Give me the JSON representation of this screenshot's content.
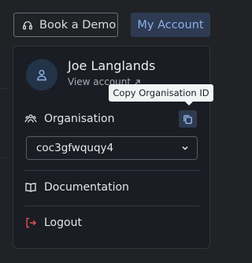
{
  "header": {
    "book_demo_label": "Book a Demo",
    "my_account_label": "My Account"
  },
  "menu": {
    "user_name": "Joe Langlands",
    "view_account_label": "View account",
    "organisation_label": "Organisation",
    "copy_tooltip": "Copy Organisation ID",
    "organisation_selected": "coc3gfwquqy4",
    "documentation_label": "Documentation",
    "logout_label": "Logout"
  },
  "icons": {
    "headset": "headset-icon",
    "user": "user-icon",
    "external_link": "external-link-icon",
    "organisation": "people-icon",
    "copy": "copy-icon",
    "chevron": "chevron-down-icon",
    "documentation": "book-icon",
    "logout": "logout-icon"
  },
  "colors": {
    "accent": "#8fb0e8",
    "accent_bg": "#2d3a52",
    "logout_icon": "#e0524f"
  }
}
